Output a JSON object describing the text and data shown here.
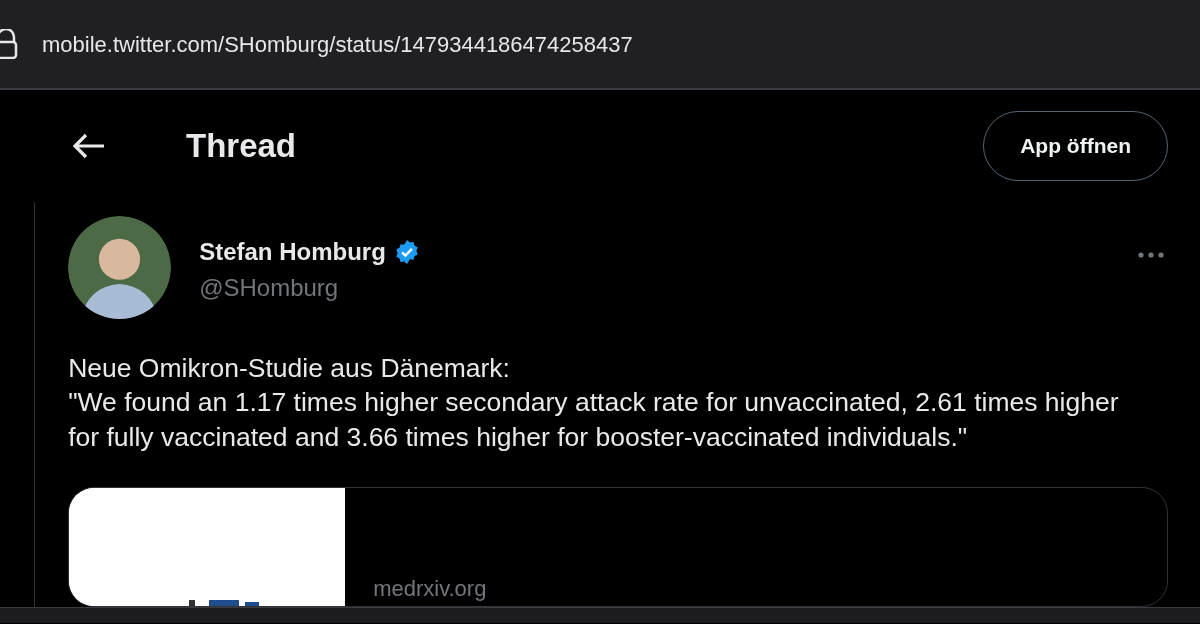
{
  "address_bar": {
    "url": "mobile.twitter.com/SHomburg/status/1479344186474258437"
  },
  "header": {
    "title": "Thread",
    "button": "App öffnen"
  },
  "tweet": {
    "author": {
      "name": "Stefan Homburg",
      "verified": true,
      "handle": "@SHomburg"
    },
    "text": [
      "Neue Omikron-Studie aus Dänemark:",
      "\"We found an 1.17 times higher secondary attack rate for unvaccinated, 2.61 times higher for fully vaccinated and 3.66 times higher for booster-vaccinated individuals.\""
    ],
    "link_card": {
      "domain": "medrxiv.org"
    }
  }
}
